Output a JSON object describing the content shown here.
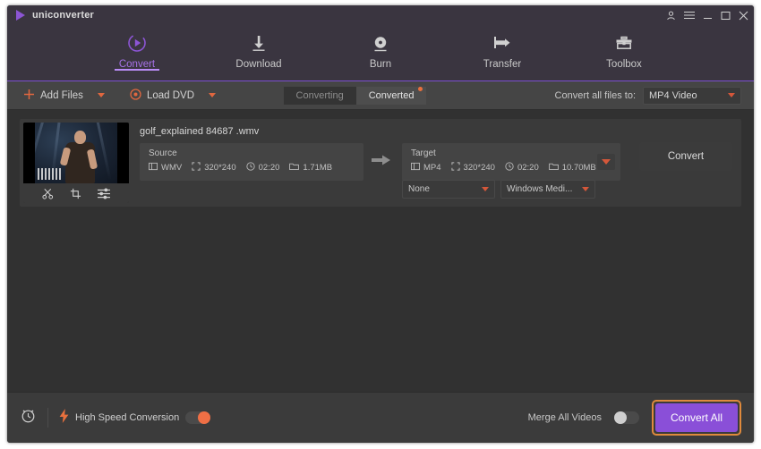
{
  "window": {
    "title": "uniconverter",
    "controls": [
      {
        "name": "account-icon",
        "glyph": "account"
      },
      {
        "name": "menu-icon",
        "glyph": "hamburger"
      },
      {
        "name": "minimize-button",
        "glyph": "minimize"
      },
      {
        "name": "maximize-button",
        "glyph": "maximize"
      },
      {
        "name": "close-button",
        "glyph": "close"
      }
    ]
  },
  "nav": {
    "tabs": [
      {
        "label": "Convert",
        "icon": "convert-icon",
        "active": true
      },
      {
        "label": "Download",
        "icon": "download-icon",
        "active": false
      },
      {
        "label": "Burn",
        "icon": "burn-icon",
        "active": false
      },
      {
        "label": "Transfer",
        "icon": "transfer-icon",
        "active": false
      },
      {
        "label": "Toolbox",
        "icon": "toolbox-icon",
        "active": false
      }
    ],
    "accent_color": "#8c55d4"
  },
  "toolbar": {
    "add_files_label": "Add Files",
    "load_dvd_label": "Load DVD",
    "segments": [
      {
        "label": "Converting",
        "active": false,
        "badge": false
      },
      {
        "label": "Converted",
        "active": true,
        "badge": true
      }
    ],
    "convert_all_to_label": "Convert all files to:",
    "convert_all_to_value": "MP4 Video",
    "accent_color": "#e0673f"
  },
  "file": {
    "name": "golf_explained 84687 .wmv",
    "thumbnail_tools": [
      {
        "name": "trim-icon",
        "label": "Trim"
      },
      {
        "name": "crop-icon",
        "label": "Crop"
      },
      {
        "name": "effects-icon",
        "label": "Effects"
      }
    ],
    "source": {
      "title": "Source",
      "format": "WMV",
      "resolution": "320*240",
      "duration": "02:20",
      "size": "1.71MB"
    },
    "target": {
      "title": "Target",
      "format": "MP4",
      "resolution": "320*240",
      "duration": "02:20",
      "size": "10.70MB"
    },
    "subtitle_value": "None",
    "audio_value": "Windows Medi...",
    "convert_button": "Convert"
  },
  "bottom": {
    "timer_icon": "alarm-clock-icon",
    "high_speed_label": "High Speed Conversion",
    "high_speed_on": true,
    "merge_label": "Merge All Videos",
    "merge_on": false,
    "convert_all_label": "Convert All",
    "convert_all_color": "#8a4fd8",
    "highlight_color": "#e08a3c"
  }
}
